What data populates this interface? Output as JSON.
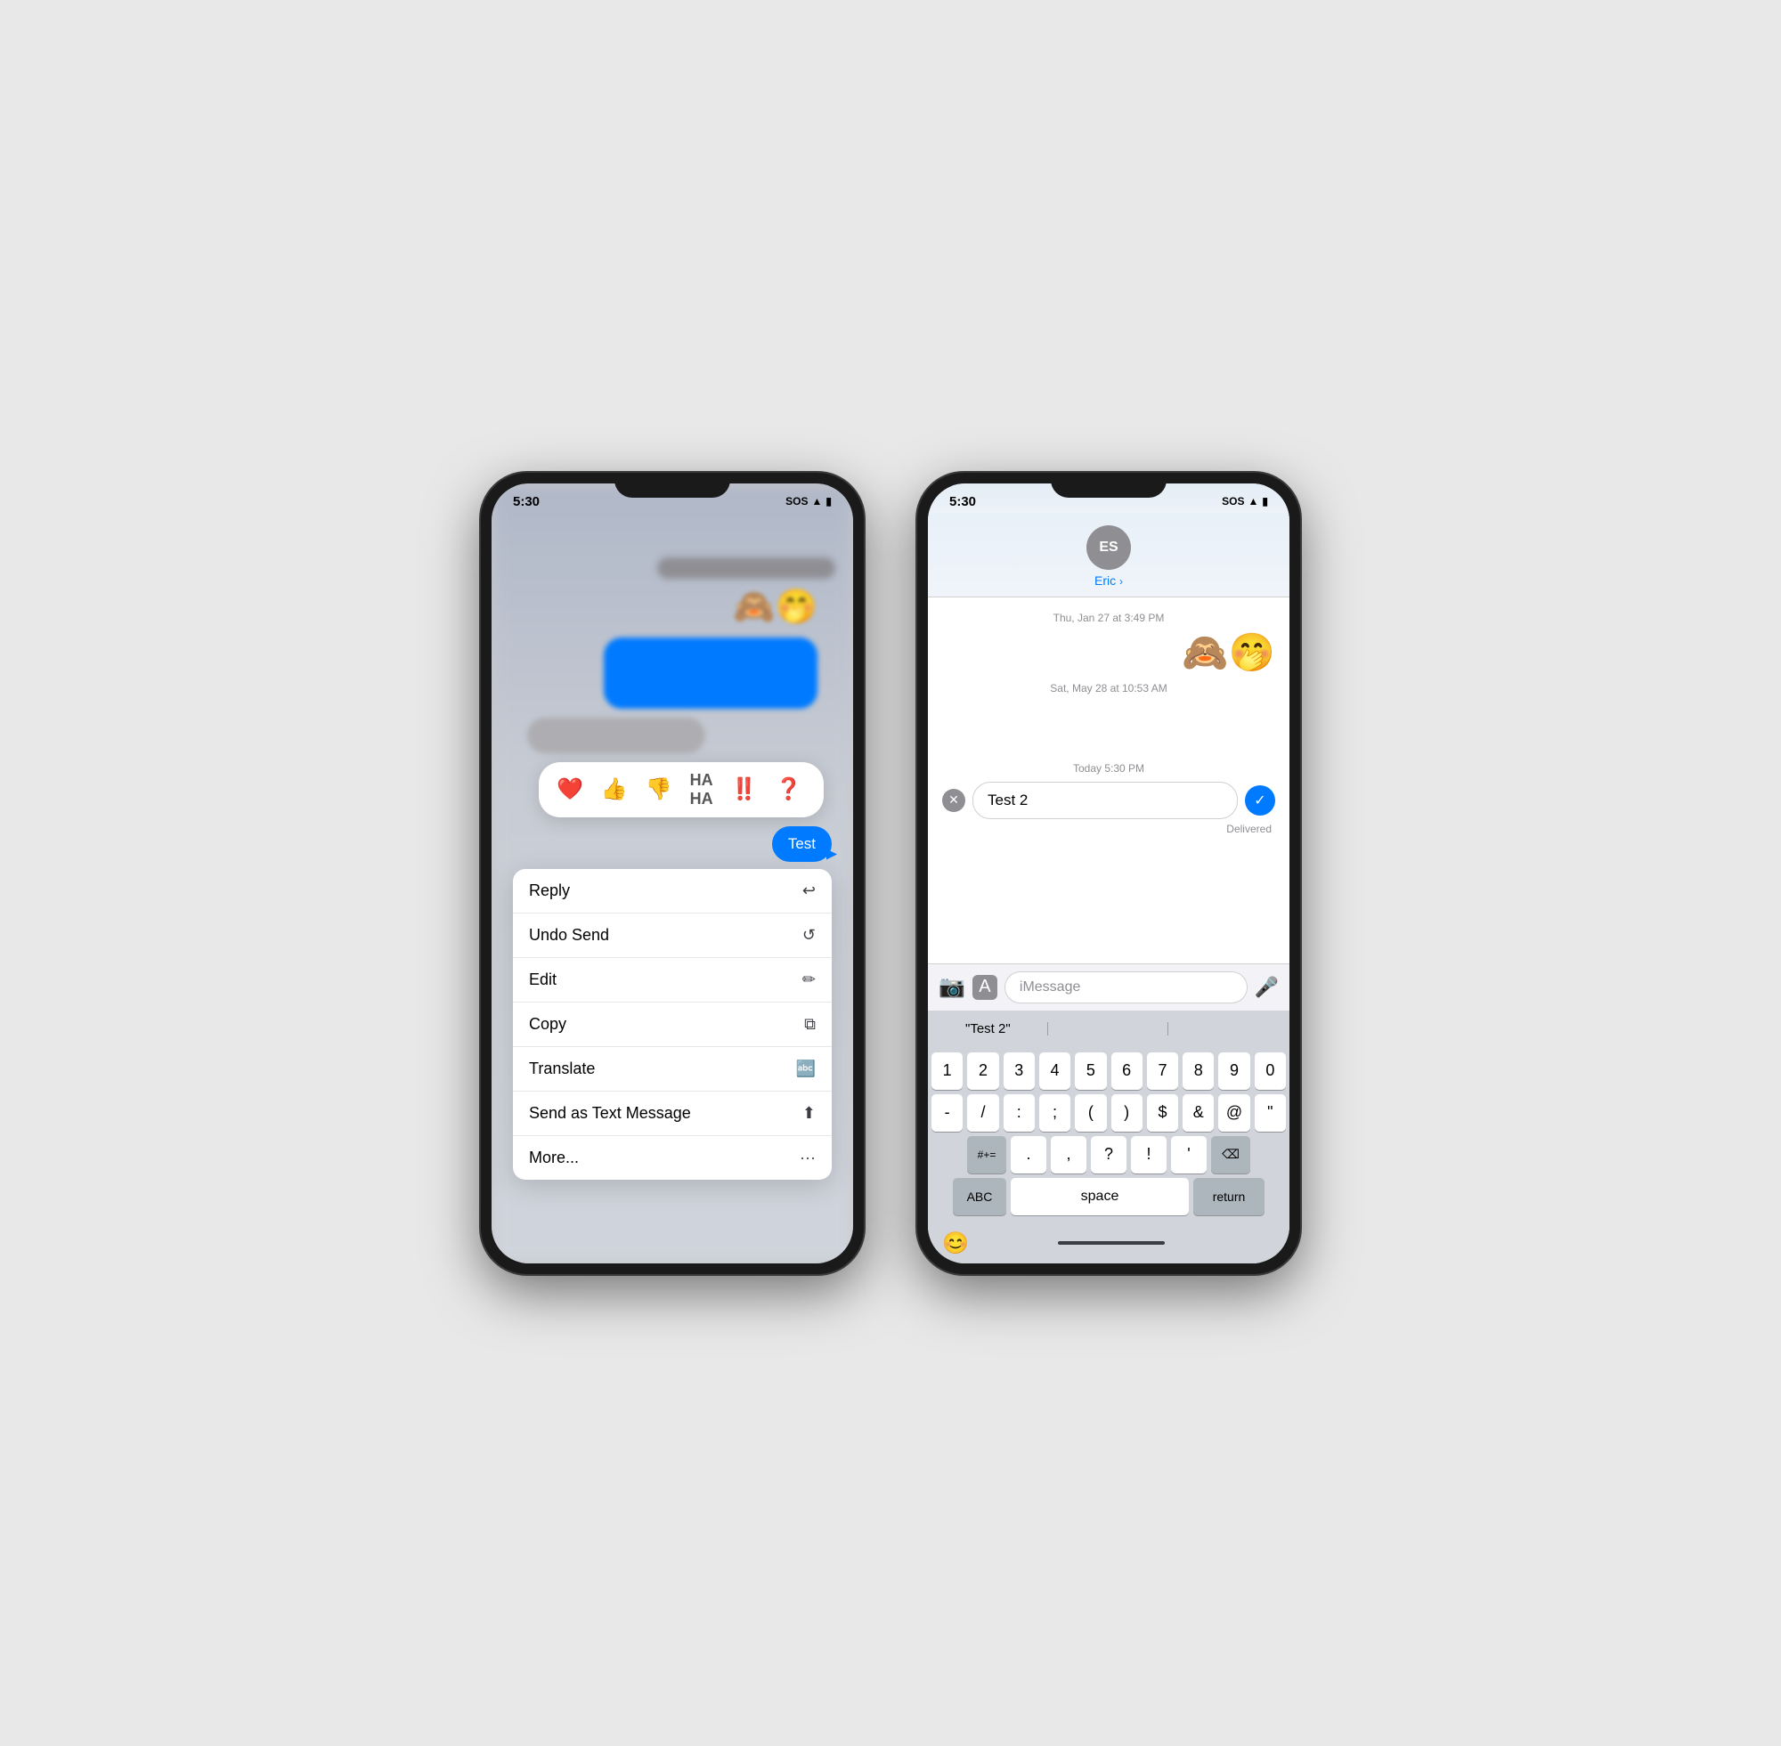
{
  "phones": {
    "left": {
      "status_time": "5:30",
      "status_sos": "SOS",
      "emojis_bg": "🙈🤭",
      "test_bubble": "Test",
      "reactions": [
        "❤️",
        "👍",
        "👎",
        "😄",
        "‼️",
        "❓"
      ],
      "context_menu": [
        {
          "label": "Reply",
          "icon": "↩"
        },
        {
          "label": "Undo Send",
          "icon": "↺"
        },
        {
          "label": "Edit",
          "icon": "✏"
        },
        {
          "label": "Copy",
          "icon": "⧉"
        },
        {
          "label": "Translate",
          "icon": "🔤"
        },
        {
          "label": "Send as Text Message",
          "icon": "⬆"
        },
        {
          "label": "More...",
          "icon": "···"
        }
      ]
    },
    "right": {
      "status_time": "5:30",
      "status_sos": "SOS",
      "contact_initials": "ES",
      "contact_name": "Eric",
      "timestamp1": "Thu, Jan 27 at 3:49 PM",
      "emojis": "🙈🤭",
      "timestamp2": "Sat, May 28 at 10:53 AM",
      "timestamp3": "Today 5:30 PM",
      "message_text": "Test 2",
      "delivered": "Delivered",
      "input_placeholder": "iMessage",
      "autocomplete_suggestion": "\"Test 2\"",
      "keyboard": {
        "row1": [
          "1",
          "2",
          "3",
          "4",
          "5",
          "6",
          "7",
          "8",
          "9",
          "0"
        ],
        "row2": [
          "-",
          "/",
          ":",
          ";",
          "(",
          ")",
          "$",
          "&",
          "@",
          "\""
        ],
        "row3_left": "#+=",
        "row3_keys": [
          ".",
          ",",
          "?",
          "!",
          "'"
        ],
        "row3_right": "⌫",
        "row4_left": "ABC",
        "row4_space": "space",
        "row4_return": "return"
      }
    }
  }
}
